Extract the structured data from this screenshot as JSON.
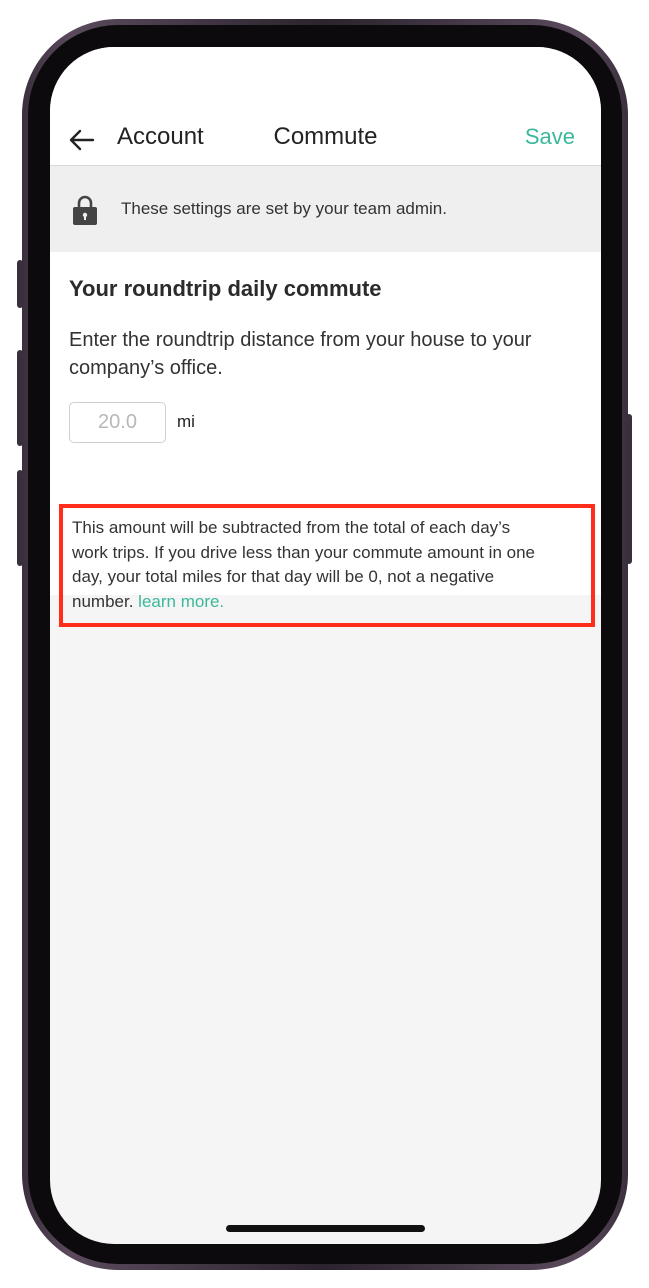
{
  "navbar": {
    "back_label": "Account",
    "title": "Commute",
    "save_label": "Save"
  },
  "banner": {
    "text": "These settings are set by your team admin."
  },
  "commute": {
    "title": "Your roundtrip daily commute",
    "description": "Enter the roundtrip distance from your house to your company’s office.",
    "distance_placeholder": "20.0",
    "unit": "mi"
  },
  "note": {
    "text": "This amount will be subtracted from the total of each day’s work trips. If you drive less than your commute amount in one day, your total miles for that day will be 0, not a negative number.",
    "link_label": "learn more."
  },
  "colors": {
    "accent": "#3bb89c",
    "highlight_border": "#ff2d1a"
  },
  "icons": {
    "back": "arrow-left-icon",
    "lock": "lock-icon"
  }
}
